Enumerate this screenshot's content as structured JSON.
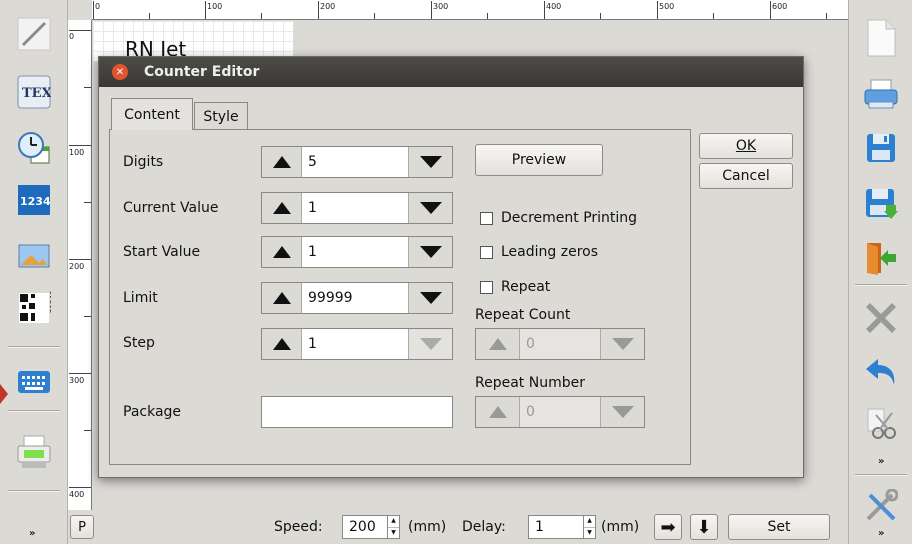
{
  "canvas": {
    "text": "RN Jet"
  },
  "ruler": {
    "h_labels": [
      "0",
      "100",
      "200",
      "300",
      "400",
      "500",
      "600"
    ],
    "v_labels": [
      "0",
      "100",
      "200",
      "300",
      "400"
    ]
  },
  "left_tools": [
    {
      "name": "line-tool",
      "icon": "pencil-line-icon"
    },
    {
      "name": "tex-tool",
      "icon": "tex-icon",
      "text": "TEX"
    },
    {
      "name": "clock-tool",
      "icon": "clock-calendar-icon"
    },
    {
      "name": "counter-tool",
      "icon": "counter-icon",
      "text": "1234"
    },
    {
      "name": "image-tool",
      "icon": "image-icon"
    },
    {
      "name": "qr-tool",
      "icon": "qr-code-icon"
    },
    {
      "name": "keyboard-tool",
      "icon": "keyboard-icon"
    },
    {
      "name": "printer-tool",
      "icon": "printer-icon"
    }
  ],
  "right_tools": [
    {
      "name": "new-file",
      "icon": "new-document-icon"
    },
    {
      "name": "print",
      "icon": "print-icon"
    },
    {
      "name": "save",
      "icon": "floppy-icon"
    },
    {
      "name": "save-as",
      "icon": "floppy-download-icon"
    },
    {
      "name": "exit",
      "icon": "exit-door-icon"
    },
    {
      "name": "delete",
      "icon": "x-icon"
    },
    {
      "name": "undo",
      "icon": "undo-arrow-icon"
    },
    {
      "name": "cut",
      "icon": "scissors-icon"
    },
    {
      "name": "settings",
      "icon": "tools-icon"
    }
  ],
  "dialog": {
    "title": "Counter Editor",
    "tabs": [
      "Content",
      "Style"
    ],
    "fields": [
      {
        "label": "Digits",
        "value": "5"
      },
      {
        "label": "Current Value",
        "value": "1"
      },
      {
        "label": "Start Value",
        "value": "1"
      },
      {
        "label": "Limit",
        "value": "99999"
      },
      {
        "label": "Step",
        "value": "1"
      }
    ],
    "package_label": "Package",
    "package_value": "",
    "preview_label": "Preview",
    "checkboxes": [
      "Decrement Printing",
      "Leading zeros",
      "Repeat"
    ],
    "repeat_count_label": "Repeat Count",
    "repeat_count_value": "0",
    "repeat_number_label": "Repeat Number",
    "repeat_number_value": "0",
    "ok_label": "OK",
    "cancel_label": "Cancel"
  },
  "bottom": {
    "p_label": "P",
    "speed_label": "Speed:",
    "speed_value": "200",
    "speed_unit": "(mm)",
    "delay_label": "Delay:",
    "delay_value": "1",
    "delay_unit": "(mm)",
    "set_label": "Set"
  }
}
